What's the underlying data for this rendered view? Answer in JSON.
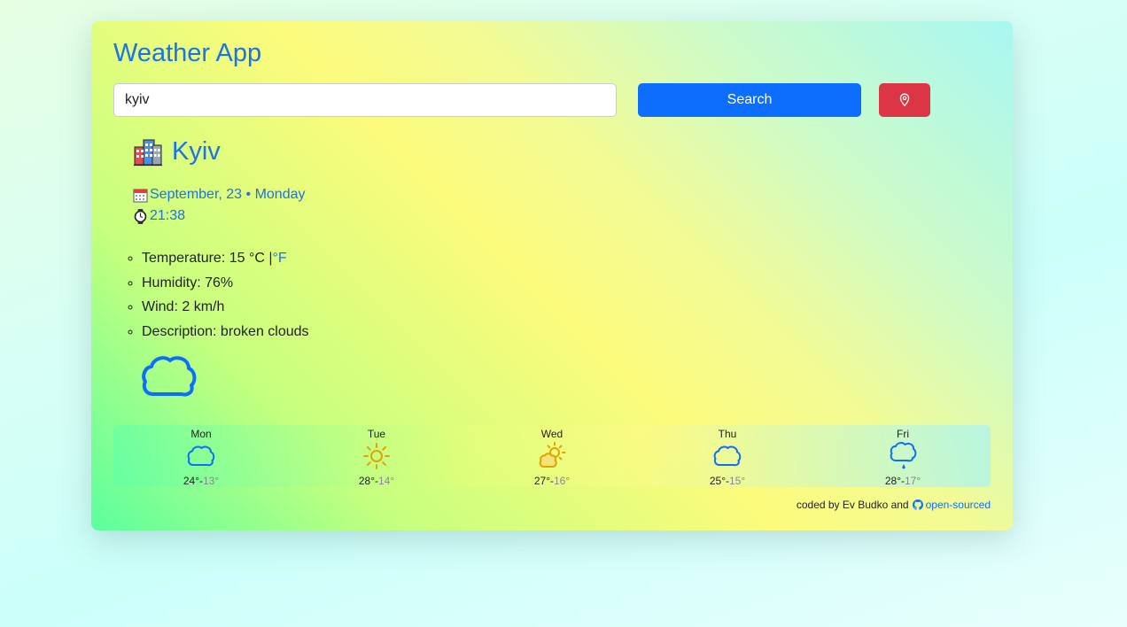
{
  "app": {
    "title": "Weather App"
  },
  "search": {
    "value": "kyiv",
    "button_label": "Search"
  },
  "location_button": {
    "icon": "map-pin-icon"
  },
  "city": {
    "name": "Kyiv",
    "icon": "city-buildings-icon"
  },
  "date_text": "September, 23 • Monday",
  "time_text": "21:38",
  "details": {
    "temperature_label": "Temperature: 15 °C |",
    "fahrenheit_link": "°F",
    "humidity": "Humidity: 76%",
    "wind": "Wind: 2 km/h",
    "description": "Description: broken clouds"
  },
  "current_icon": "cloud-icon",
  "forecast": [
    {
      "day": "Mon",
      "max": "24°",
      "sep": "-",
      "min": "13°",
      "icon": "cloud-icon"
    },
    {
      "day": "Tue",
      "max": "28°",
      "sep": "-",
      "min": "14°",
      "icon": "sun-icon"
    },
    {
      "day": "Wed",
      "max": "27°",
      "sep": "-",
      "min": "16°",
      "icon": "sun-cloud-icon"
    },
    {
      "day": "Thu",
      "max": "25°",
      "sep": "-",
      "min": "15°",
      "icon": "cloud-icon"
    },
    {
      "day": "Fri",
      "max": "28°",
      "sep": "-",
      "min": "17°",
      "icon": "cloud-drizzle-icon"
    }
  ],
  "footer": {
    "text": "coded by Ev Budko and",
    "link_label": "open-sourced",
    "link_icon": "github-icon"
  },
  "colors": {
    "accent": "#1a73e8",
    "search_button": "#0d6efd",
    "location_button": "#dc3545",
    "sun": "#e0a400"
  }
}
